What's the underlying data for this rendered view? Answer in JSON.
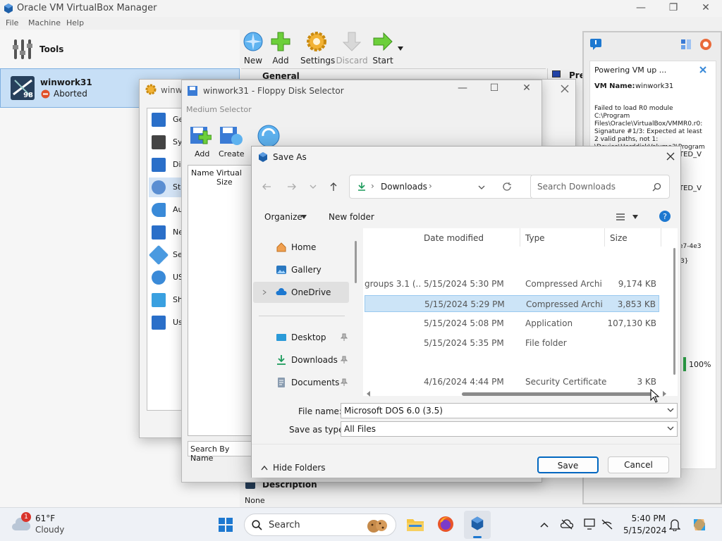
{
  "vbox": {
    "title": "Oracle VM VirtualBox Manager",
    "menu": [
      "File",
      "Machine",
      "Help"
    ],
    "tools_label": "Tools",
    "vm": {
      "name": "winwork31",
      "status": "Aborted",
      "os_badge": "98"
    },
    "toolbar": [
      "New",
      "Add",
      "Settings",
      "Discard",
      "Start"
    ],
    "section_general": "General",
    "section_preview": "Prev",
    "section_description": "Description",
    "description_value": "None"
  },
  "notification": {
    "title": "Powering VM up ...",
    "vm_name_label": "VM Name:",
    "vm_name": "winwork31",
    "message": "Failed to load R0 module C:\\Program Files\\Oracle\\VirtualBox/VMMR0.r0: Signature #1/3: Expected at least 2 valid paths, not 1: \\Device\\HarddiskVolume3\\Program",
    "frag1": "TED_V",
    "frag2": "TED_V",
    "frag3": "e7-4e3",
    "frag4": "3}",
    "progress": "100%"
  },
  "settings_dialog": {
    "title": "winw",
    "items": [
      "Ge",
      "Sys",
      "Dis",
      "Sto",
      "Au",
      "Ne",
      "Ser",
      "US",
      "Sha",
      "Us"
    ]
  },
  "floppy": {
    "title": "winwork31 - Floppy Disk Selector",
    "subtitle": "Medium Selector",
    "add": "Add",
    "create": "Create",
    "col_name": "Name",
    "col_size": "Virtual Size",
    "search": "Search By Name"
  },
  "saveas": {
    "title": "Save As",
    "address": "Downloads",
    "search_placeholder": "Search Downloads",
    "organize": "Organize",
    "new_folder": "New folder",
    "nav": [
      "Home",
      "Gallery",
      "OneDrive",
      "Desktop",
      "Downloads",
      "Documents"
    ],
    "headers": {
      "date": "Date modified",
      "type": "Type",
      "size": "Size"
    },
    "files": [
      {
        "name": "groups 3.1 (...",
        "date": "5/15/2024 5:30 PM",
        "type": "Compressed Archi...",
        "size": "9,174 KB"
      },
      {
        "name": "",
        "date": "5/15/2024 5:29 PM",
        "type": "Compressed Archi...",
        "size": "3,853 KB"
      },
      {
        "name": "",
        "date": "5/15/2024 5:08 PM",
        "type": "Application",
        "size": "107,130 KB"
      },
      {
        "name": "",
        "date": "5/15/2024 5:35 PM",
        "type": "File folder",
        "size": ""
      },
      {
        "name": "",
        "date": "4/16/2024 4:44 PM",
        "type": "Security Certificate",
        "size": "3 KB"
      }
    ],
    "file_name_label": "File name:",
    "file_name_value": "Microsoft DOS 6.0 (3.5)",
    "save_type_label": "Save as type:",
    "save_type_value": "All Files",
    "hide_folders": "Hide Folders",
    "save": "Save",
    "cancel": "Cancel"
  },
  "taskbar": {
    "weather_temp": "61°F",
    "weather_desc": "Cloudy",
    "weather_badge": "1",
    "search": "Search",
    "time": "5:40 PM",
    "date": "5/15/2024"
  }
}
